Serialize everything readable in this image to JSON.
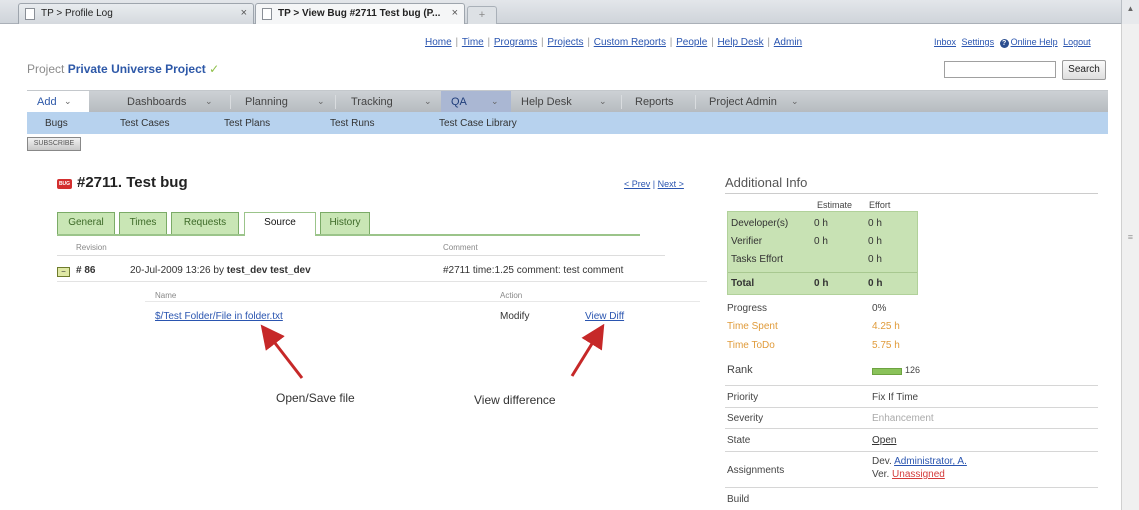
{
  "browser": {
    "tab1": "TP > Profile Log",
    "tab1_close": "×",
    "tab2": "TP > View Bug #2711 Test bug (P...",
    "tab2_close": "×",
    "new_tab": "+"
  },
  "toplinks": [
    "Home",
    "Time",
    "Programs",
    "Projects",
    "Custom Reports",
    "People",
    "Help Desk",
    "Admin"
  ],
  "toplinks_sep": "|",
  "userlinks": {
    "inbox": "Inbox",
    "settings": "Settings",
    "help": "Online Help",
    "logout": "Logout"
  },
  "project": {
    "prefix": "Project",
    "name": "Private Universe Project",
    "check": "✓"
  },
  "search": {
    "button": "Search",
    "value": ""
  },
  "menu": {
    "dropdown_glyph": "⌄",
    "items": [
      "Add",
      "Dashboards",
      "Planning",
      "Tracking",
      "QA",
      "Help Desk",
      "Reports",
      "Project Admin"
    ]
  },
  "submenu": [
    "Bugs",
    "Test Cases",
    "Test Plans",
    "Test Runs",
    "Test Case Library"
  ],
  "subscribe": "SUBSCRIBE",
  "bug": {
    "badge": "BUG",
    "title": "#2711. Test bug",
    "prev": "< Prev",
    "next": "Next >",
    "pn_sep": "|"
  },
  "tabs": [
    "General",
    "Times",
    "Requests",
    "Source",
    "History"
  ],
  "source": {
    "col_revision": "Revision",
    "col_comment": "Comment",
    "collapse": "−",
    "revision": "# 86",
    "date": "20-Jul-2009 13:26 by",
    "user": "test_dev test_dev",
    "comment": "#2711 time:1.25 comment: test comment",
    "col_name": "Name",
    "col_action": "Action",
    "file": "$/Test Folder/File in folder.txt",
    "action": "Modify",
    "view_diff": "View Diff"
  },
  "annotations": {
    "open_save": "Open/Save file",
    "view_difference": "View difference"
  },
  "additional": {
    "title": "Additional Info",
    "estimate": "Estimate",
    "effort": "Effort",
    "rows": [
      {
        "label": "Developer(s)",
        "estimate": "0 h",
        "effort": "0 h"
      },
      {
        "label": "Verifier",
        "estimate": "0 h",
        "effort": "0 h"
      },
      {
        "label": "Tasks Effort",
        "estimate": "",
        "effort": "0 h"
      },
      {
        "label": "Total",
        "estimate": "0 h",
        "effort": "0 h"
      }
    ],
    "progress_label": "Progress",
    "progress": "0%",
    "spent_label": "Time Spent",
    "spent": "4.25 h",
    "todo_label": "Time ToDo",
    "todo": "5.75 h",
    "rank_label": "Rank",
    "rank": "126",
    "priority_label": "Priority",
    "priority": "Fix If Time",
    "severity_label": "Severity",
    "severity": "Enhancement",
    "state_label": "State",
    "state": "Open",
    "assign_label": "Assignments",
    "dev_prefix": "Dev.",
    "dev": "Administrator, A.",
    "ver_prefix": "Ver.",
    "ver": "Unassigned",
    "build_label": "Build"
  },
  "colors": {
    "green": "#c8e2b4",
    "menu_blue": "#b7d2ee",
    "orange": "#e09b3a",
    "badge_red": "#d32f2f"
  }
}
